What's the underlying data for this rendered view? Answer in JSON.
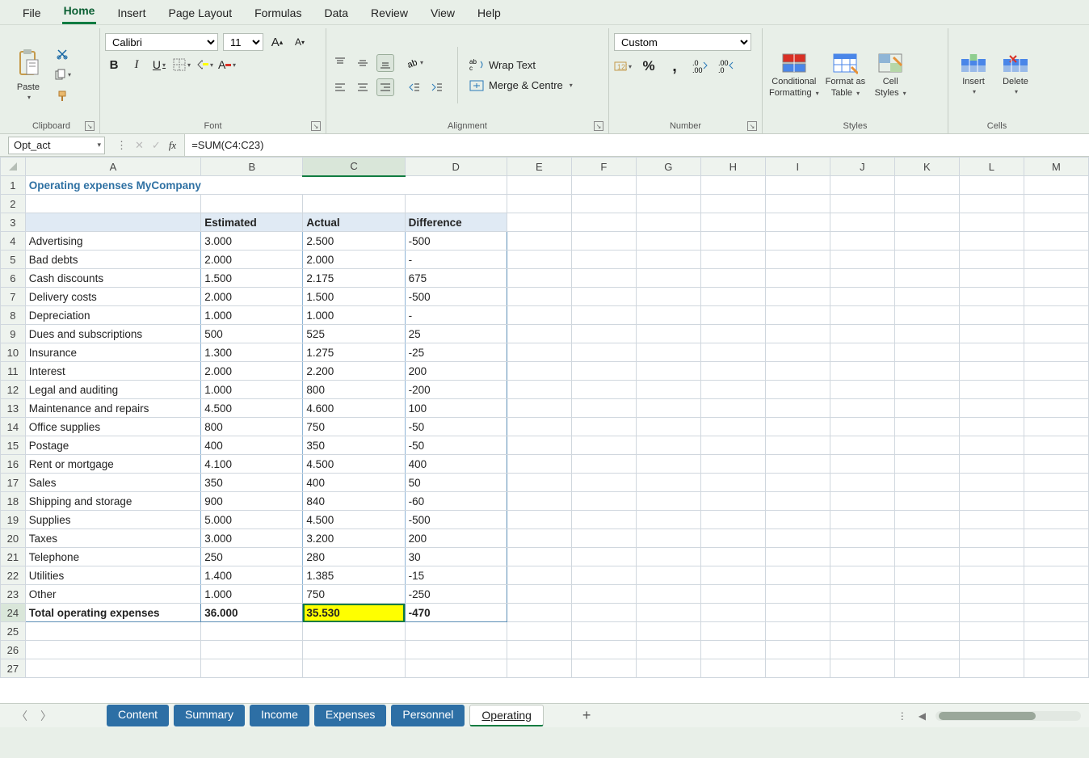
{
  "menu": {
    "items": [
      "File",
      "Home",
      "Insert",
      "Page Layout",
      "Formulas",
      "Data",
      "Review",
      "View",
      "Help"
    ],
    "active": "Home"
  },
  "ribbon": {
    "clipboard": {
      "paste": "Paste",
      "label": "Clipboard"
    },
    "font": {
      "name": "Calibri",
      "size": "11",
      "label": "Font"
    },
    "alignment": {
      "wrap": "Wrap Text",
      "merge": "Merge & Centre",
      "label": "Alignment"
    },
    "number": {
      "format": "Custom",
      "label": "Number"
    },
    "styles": {
      "cond": "Conditional",
      "cond2": "Formatting",
      "fmt": "Format as",
      "fmt2": "Table",
      "cell": "Cell",
      "cell2": "Styles",
      "label": "Styles"
    },
    "cells": {
      "insert": "Insert",
      "delete": "Delete",
      "label": "Cells"
    }
  },
  "formula_bar": {
    "name": "Opt_act",
    "fx": "fx",
    "formula": "=SUM(C4:C23)"
  },
  "columns": [
    "A",
    "B",
    "C",
    "D",
    "E",
    "F",
    "G",
    "H",
    "I",
    "J",
    "K",
    "L",
    "M"
  ],
  "sheet": {
    "title": "Operating expenses MyCompany",
    "headers": {
      "est": "Estimated",
      "act": "Actual",
      "diff": "Difference"
    },
    "rows": [
      {
        "label": "Advertising",
        "est": "3.000",
        "act": "2.500",
        "diff": "-500"
      },
      {
        "label": "Bad debts",
        "est": "2.000",
        "act": "2.000",
        "diff": "-"
      },
      {
        "label": "Cash discounts",
        "est": "1.500",
        "act": "2.175",
        "diff": "675"
      },
      {
        "label": "Delivery costs",
        "est": "2.000",
        "act": "1.500",
        "diff": "-500"
      },
      {
        "label": "Depreciation",
        "est": "1.000",
        "act": "1.000",
        "diff": "-"
      },
      {
        "label": "Dues and subscriptions",
        "est": "500",
        "act": "525",
        "diff": "25"
      },
      {
        "label": "Insurance",
        "est": "1.300",
        "act": "1.275",
        "diff": "-25"
      },
      {
        "label": "Interest",
        "est": "2.000",
        "act": "2.200",
        "diff": "200"
      },
      {
        "label": "Legal and auditing",
        "est": "1.000",
        "act": "800",
        "diff": "-200"
      },
      {
        "label": "Maintenance and repairs",
        "est": "4.500",
        "act": "4.600",
        "diff": "100"
      },
      {
        "label": "Office supplies",
        "est": "800",
        "act": "750",
        "diff": "-50"
      },
      {
        "label": "Postage",
        "est": "400",
        "act": "350",
        "diff": "-50"
      },
      {
        "label": "Rent or mortgage",
        "est": "4.100",
        "act": "4.500",
        "diff": "400"
      },
      {
        "label": "Sales",
        "est": "350",
        "act": "400",
        "diff": "50"
      },
      {
        "label": "Shipping and storage",
        "est": "900",
        "act": "840",
        "diff": "-60"
      },
      {
        "label": "Supplies",
        "est": "5.000",
        "act": "4.500",
        "diff": "-500"
      },
      {
        "label": "Taxes",
        "est": "3.000",
        "act": "3.200",
        "diff": "200"
      },
      {
        "label": "Telephone",
        "est": "250",
        "act": "280",
        "diff": "30"
      },
      {
        "label": "Utilities",
        "est": "1.400",
        "act": "1.385",
        "diff": "-15"
      },
      {
        "label": "Other",
        "est": "1.000",
        "act": "750",
        "diff": "-250"
      }
    ],
    "total": {
      "label": "Total operating expenses",
      "est": "36.000",
      "act": "35.530",
      "diff": "-470"
    }
  },
  "sheet_tabs": {
    "tabs": [
      "Content",
      "Summary",
      "Income",
      "Expenses",
      "Personnel"
    ],
    "active": "Operating"
  }
}
